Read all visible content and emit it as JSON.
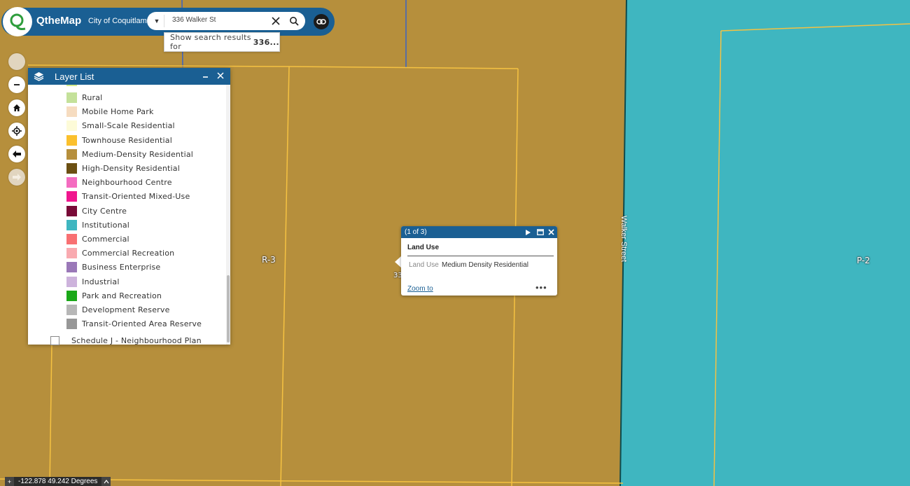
{
  "header": {
    "brand": "QtheMap",
    "city": "City of Coquitlam"
  },
  "search": {
    "value": "336 Walker St",
    "suggestion_prefix": "Show search results for ",
    "suggestion_term": "336..."
  },
  "map": {
    "labels": {
      "zone_left": "R-3",
      "zone_right": "P-2",
      "street": "Walker Street",
      "address_partial": "33"
    },
    "colors": {
      "medium_density": "#b68f3c",
      "institutional": "#3fb6c0",
      "parcel_line": "#f5c242",
      "road_line": "#3a62c4"
    }
  },
  "layer_list": {
    "title": "Layer List",
    "items": [
      {
        "label": "Rural",
        "color": "#c4e19a"
      },
      {
        "label": "Mobile Home Park",
        "color": "#f6dcc0"
      },
      {
        "label": "Small-Scale Residential",
        "color": "#fdfbd8"
      },
      {
        "label": "Townhouse Residential",
        "color": "#fbc02d"
      },
      {
        "label": "Medium-Density Residential",
        "color": "#b68f3c"
      },
      {
        "label": "High-Density Residential",
        "color": "#6b4f12"
      },
      {
        "label": "Neighbourhood Centre",
        "color": "#f46cc0"
      },
      {
        "label": "Transit-Oriented Mixed-Use",
        "color": "#f0168e"
      },
      {
        "label": "City Centre",
        "color": "#780a37"
      },
      {
        "label": "Institutional",
        "color": "#3fb6c0"
      },
      {
        "label": "Commercial",
        "color": "#f87072"
      },
      {
        "label": "Commercial Recreation",
        "color": "#f9aab0"
      },
      {
        "label": "Business Enterprise",
        "color": "#9a78b8"
      },
      {
        "label": "Industrial",
        "color": "#cdb3dc"
      },
      {
        "label": "Park and Recreation",
        "color": "#1aa818"
      },
      {
        "label": "Development Reserve",
        "color": "#b7b7b7"
      },
      {
        "label": "Transit-Oriented Area Reserve",
        "color": "#979797"
      }
    ],
    "schedule_row": "Schedule J - Neighbourhood Plan"
  },
  "popup": {
    "count": "(1 of 3)",
    "title": "Land Use",
    "field_label": "Land Use",
    "field_value": "Medium Density Residential",
    "zoom_label": "Zoom to",
    "more": "•••"
  },
  "coordinates": {
    "text": "-122.878 49.242 Degrees"
  }
}
